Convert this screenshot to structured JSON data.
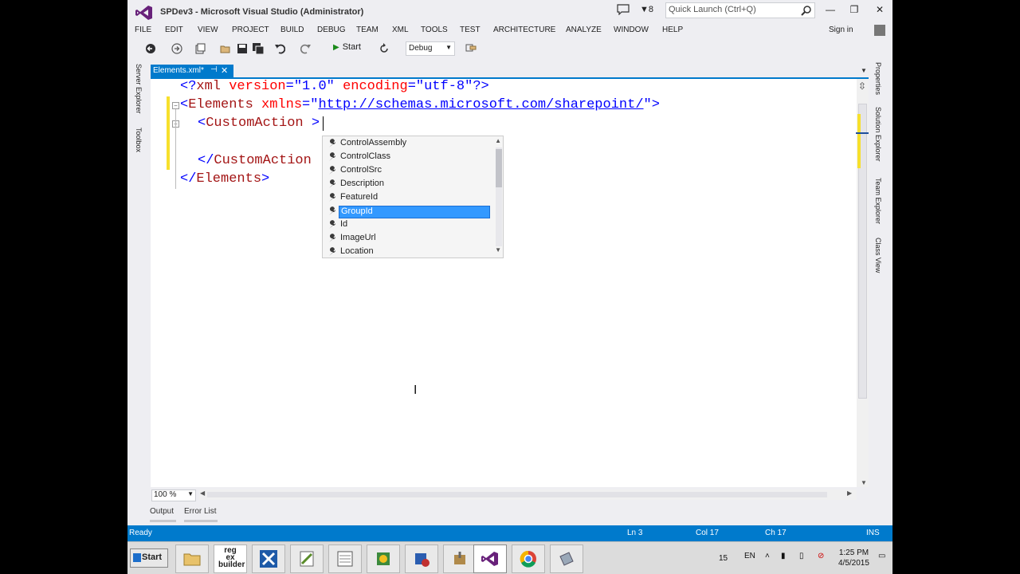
{
  "window": {
    "title": "SPDev3 - Microsoft Visual Studio (Administrator)",
    "notification_count": "8",
    "quick_launch_placeholder": "Quick Launch (Ctrl+Q)",
    "signin_label": "Sign in",
    "brand_color": "#68217a",
    "accent_color": "#007acc"
  },
  "menu": [
    "FILE",
    "EDIT",
    "VIEW",
    "PROJECT",
    "BUILD",
    "DEBUG",
    "TEAM",
    "XML",
    "TOOLS",
    "TEST",
    "ARCHITECTURE",
    "ANALYZE",
    "WINDOW",
    "HELP"
  ],
  "toolbar": {
    "start_label": "Start",
    "config_value": "Debug"
  },
  "left_tabs": [
    "Server Explorer",
    "Toolbox"
  ],
  "right_tabs": [
    "Properties",
    "Solution Explorer",
    "Team Explorer",
    "Class View"
  ],
  "document_tab": {
    "label": "Elements.xml*",
    "pin_icon": "pin-icon",
    "close_icon": "close-icon"
  },
  "code": {
    "line1": {
      "open": "<?",
      "tag": "xml",
      "a1": "version",
      "v1": "\"1.0\"",
      "a2": "encoding",
      "v2": "\"utf-8\"",
      "close": "?>"
    },
    "line2": {
      "open": "<",
      "tag": "Elements",
      "attr": "xmlns",
      "eq": "=",
      "q1": "\"",
      "url": "http://schemas.microsoft.com/sharepoint/",
      "q2": "\"",
      "close": ">"
    },
    "line3": {
      "open": "<",
      "tag": "CustomAction",
      "close": ">"
    },
    "line5": {
      "open": "</",
      "tag": "CustomAction"
    },
    "line6": {
      "open": "</",
      "tag": "Elements",
      "close": ">"
    }
  },
  "intellisense": {
    "items": [
      "ControlAssembly",
      "ControlClass",
      "ControlSrc",
      "Description",
      "FeatureId",
      "GroupId",
      "Id",
      "ImageUrl",
      "Location"
    ],
    "selected": "GroupId",
    "selected_color": "#3399ff"
  },
  "editor_footer": {
    "zoom": "100 %"
  },
  "bottom_tabs": [
    "Output",
    "Error List"
  ],
  "status": {
    "state": "Ready",
    "line": "Ln 3",
    "col": "Col 17",
    "ch": "Ch 17",
    "mode": "INS"
  },
  "taskbar": {
    "start_label": "Start",
    "apps": [
      "file-explorer-icon",
      "regex-builder-icon",
      "tools-icon",
      "notepad-icon",
      "calculator-icon",
      "paint-icon",
      "server-icon",
      "tools2-icon",
      "visual-studio-icon",
      "chrome-icon",
      "app-icon"
    ],
    "regex_label_1": "reg",
    "regex_label_2": "ex",
    "regex_label_3": "builder",
    "tray_number": "15",
    "language": "EN",
    "time": "1:25 PM",
    "date": "4/5/2015"
  }
}
